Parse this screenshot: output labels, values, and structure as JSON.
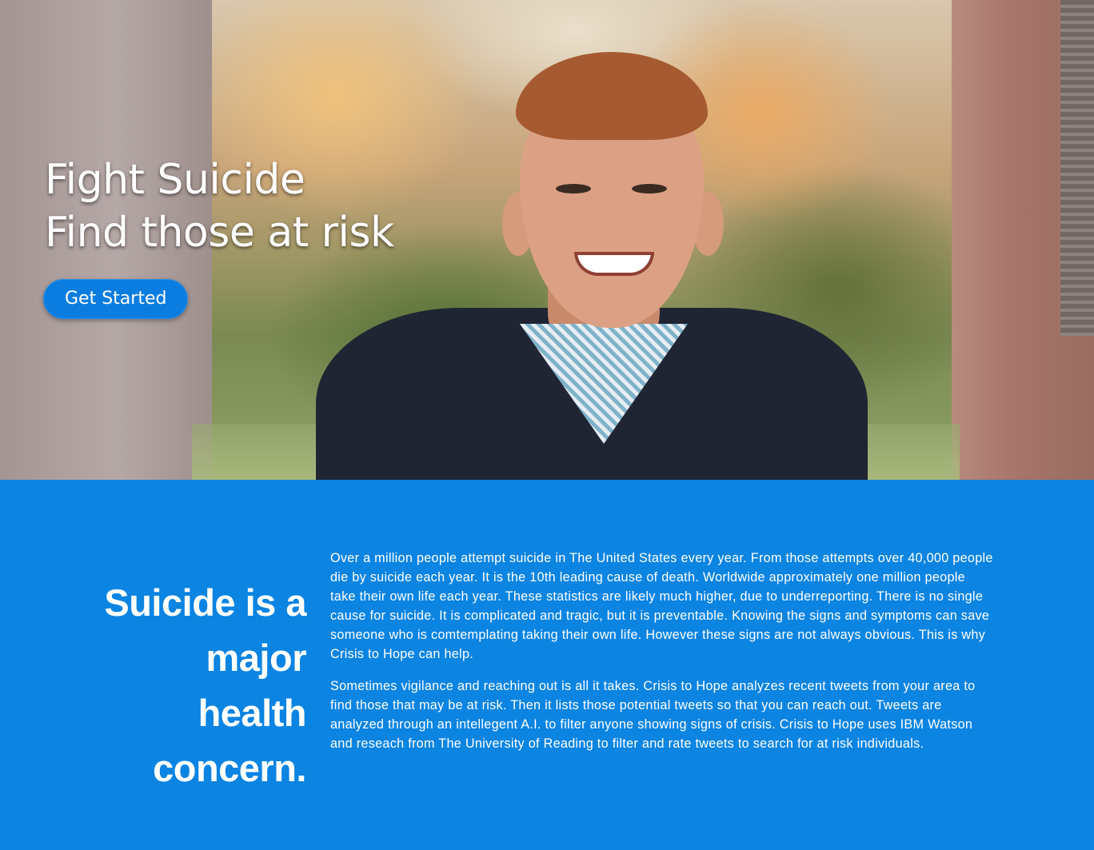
{
  "hero": {
    "line1": "Fight Suicide",
    "line2": "Find those at risk",
    "cta_label": "Get Started",
    "background_image": "smiling red-haired man in dark sweater, outdoor blurred autumn trees"
  },
  "info": {
    "heading": "Suicide is a major health concern.",
    "paragraphs": [
      "Over a million people attempt suicide in The United States every year. From those attempts over 40,000 people die by suicide each year. It is the 10th leading cause of death. Worldwide approximately one million people take their own life each year. These statistics are likely much higher, due to underreporting. There is no single cause for suicide. It is complicated and tragic, but it is preventable. Knowing the signs and symptoms can save someone who is comtemplating taking their own life. However these signs are not always obvious. This is why Crisis to Hope can help.",
      "Sometimes vigilance and reaching out is all it takes. Crisis to Hope analyzes recent tweets from your area to find those that may be at risk. Then it lists those potential tweets so that you can reach out. Tweets are analyzed through an intellegent A.I. to filter anyone showing signs of crisis. Crisis to Hope uses IBM Watson and reseach from The University of Reading to filter and rate tweets to search for at risk individuals."
    ]
  },
  "colors": {
    "accent": "#0b84e2",
    "button": "#0b7de0",
    "text_on_accent": "#ffffff"
  }
}
